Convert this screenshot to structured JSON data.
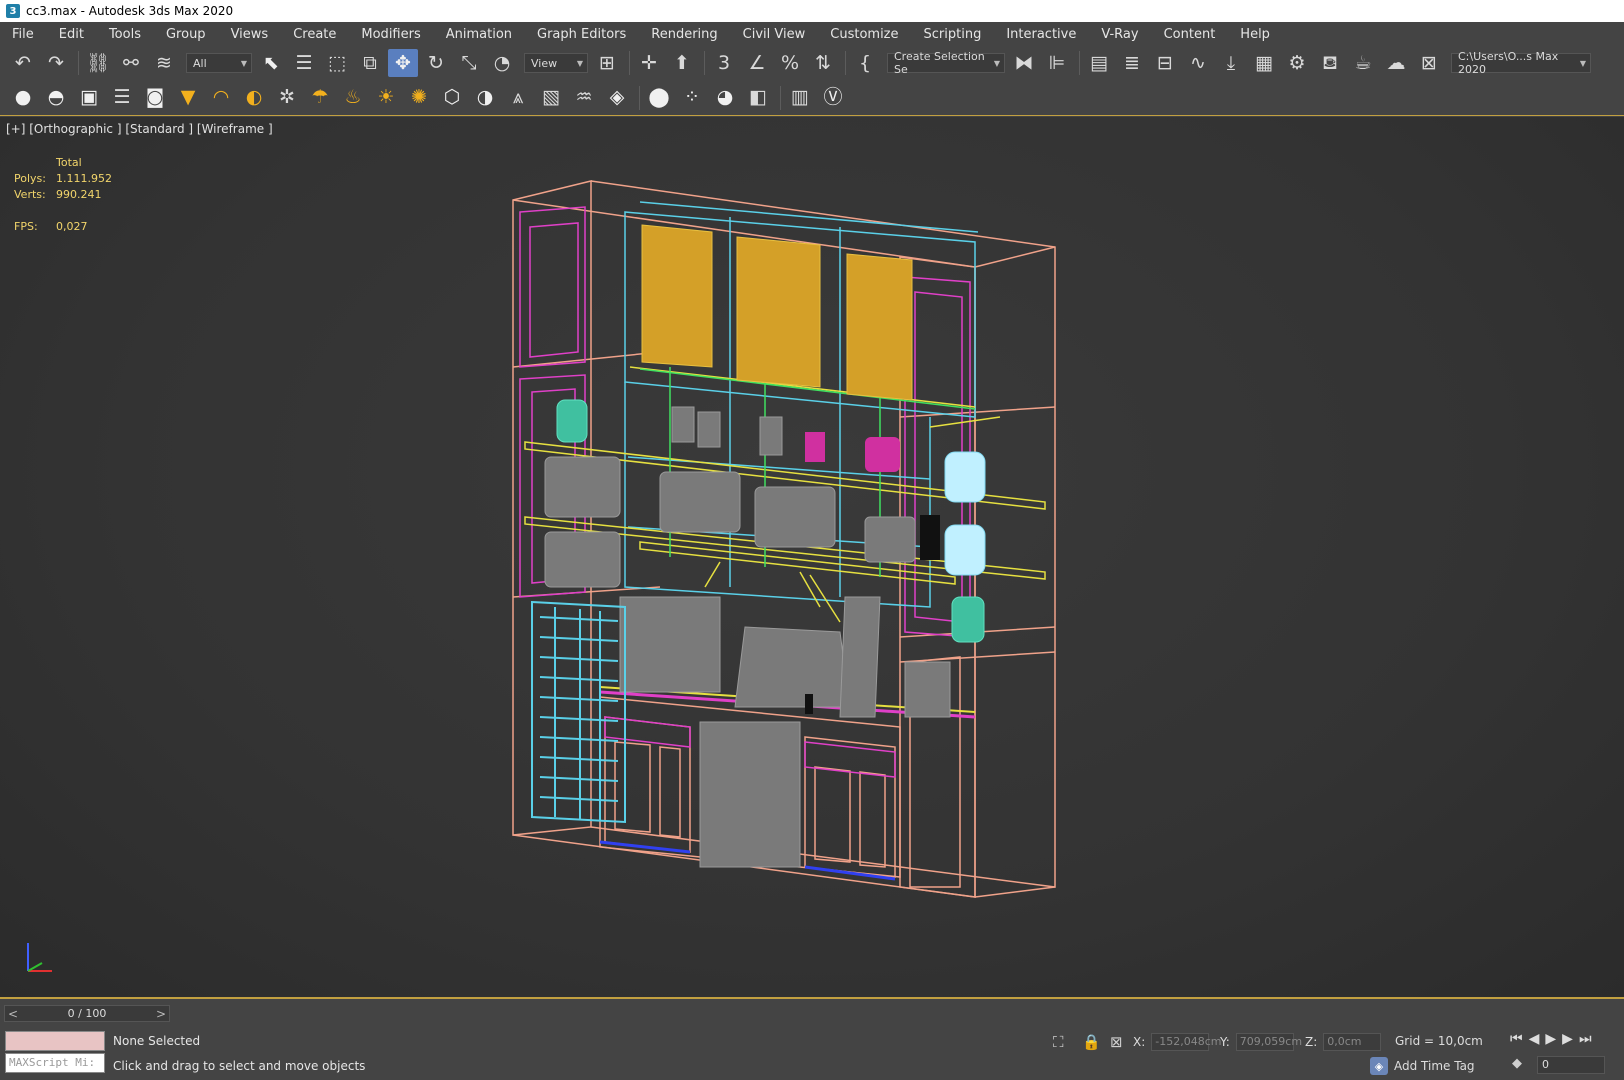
{
  "window": {
    "title": "cc3.max - Autodesk 3ds Max 2020",
    "icon": "3"
  },
  "menu": [
    "File",
    "Edit",
    "Tools",
    "Group",
    "Views",
    "Create",
    "Modifiers",
    "Animation",
    "Graph Editors",
    "Rendering",
    "Civil View",
    "Customize",
    "Scripting",
    "Interactive",
    "V-Ray",
    "Content",
    "Help"
  ],
  "toolbar": {
    "filter_value": "All",
    "coord_system": "View",
    "selection_set_placeholder": "Create Selection Se",
    "project_path": "C:\\Users\\O...s Max 2020",
    "snap_label": "3",
    "icons": [
      "undo-icon",
      "redo-icon",
      "link-icon",
      "unlink-icon",
      "bind-space-warp-icon",
      "select-icon",
      "select-by-name-icon",
      "rect-region-icon",
      "window-crossing-icon",
      "move-icon",
      "rotate-icon",
      "scale-icon",
      "place-icon",
      "pivot-icon",
      "manipulate-icon",
      "snap-icon",
      "angle-snap-icon",
      "percent-snap-icon",
      "spinner-snap-icon",
      "edit-named-sets-icon",
      "mirror-icon",
      "align-icon",
      "scene-explorer-icon",
      "layer-explorer-icon",
      "ribbon-icon",
      "curve-editor-icon",
      "schematic-view-icon",
      "material-editor-icon",
      "render-setup-icon",
      "rendered-frame-icon",
      "render-icon",
      "render-iterative-icon",
      "render-cloud-icon"
    ]
  },
  "viewport": {
    "label": "[+] [Orthographic ] [Standard ] [Wireframe ]",
    "stats": {
      "header": "Total",
      "polys_label": "Polys:",
      "polys": "1.111.952",
      "verts_label": "Verts:",
      "verts": "990.241",
      "fps_label": "FPS:",
      "fps": "0,027"
    }
  },
  "status": {
    "frame": "0 / 100",
    "prev": "<",
    "next": ">",
    "maxscript_placeholder": "MAXScript Mi:",
    "selection": "None Selected",
    "prompt": "Click and drag to select and move objects",
    "x_label": "X:",
    "x": "-152,048cm",
    "y_label": "Y:",
    "y": "709,059cm",
    "z_label": "Z:",
    "z": "0,0cm",
    "grid": "Grid = 10,0cm",
    "time_tag": "Add Time Tag",
    "current_frame": "0"
  },
  "colors": {
    "accent_border": "#c2a040",
    "active_tool": "#5a7fbf",
    "stats_text": "#f2d56b"
  }
}
